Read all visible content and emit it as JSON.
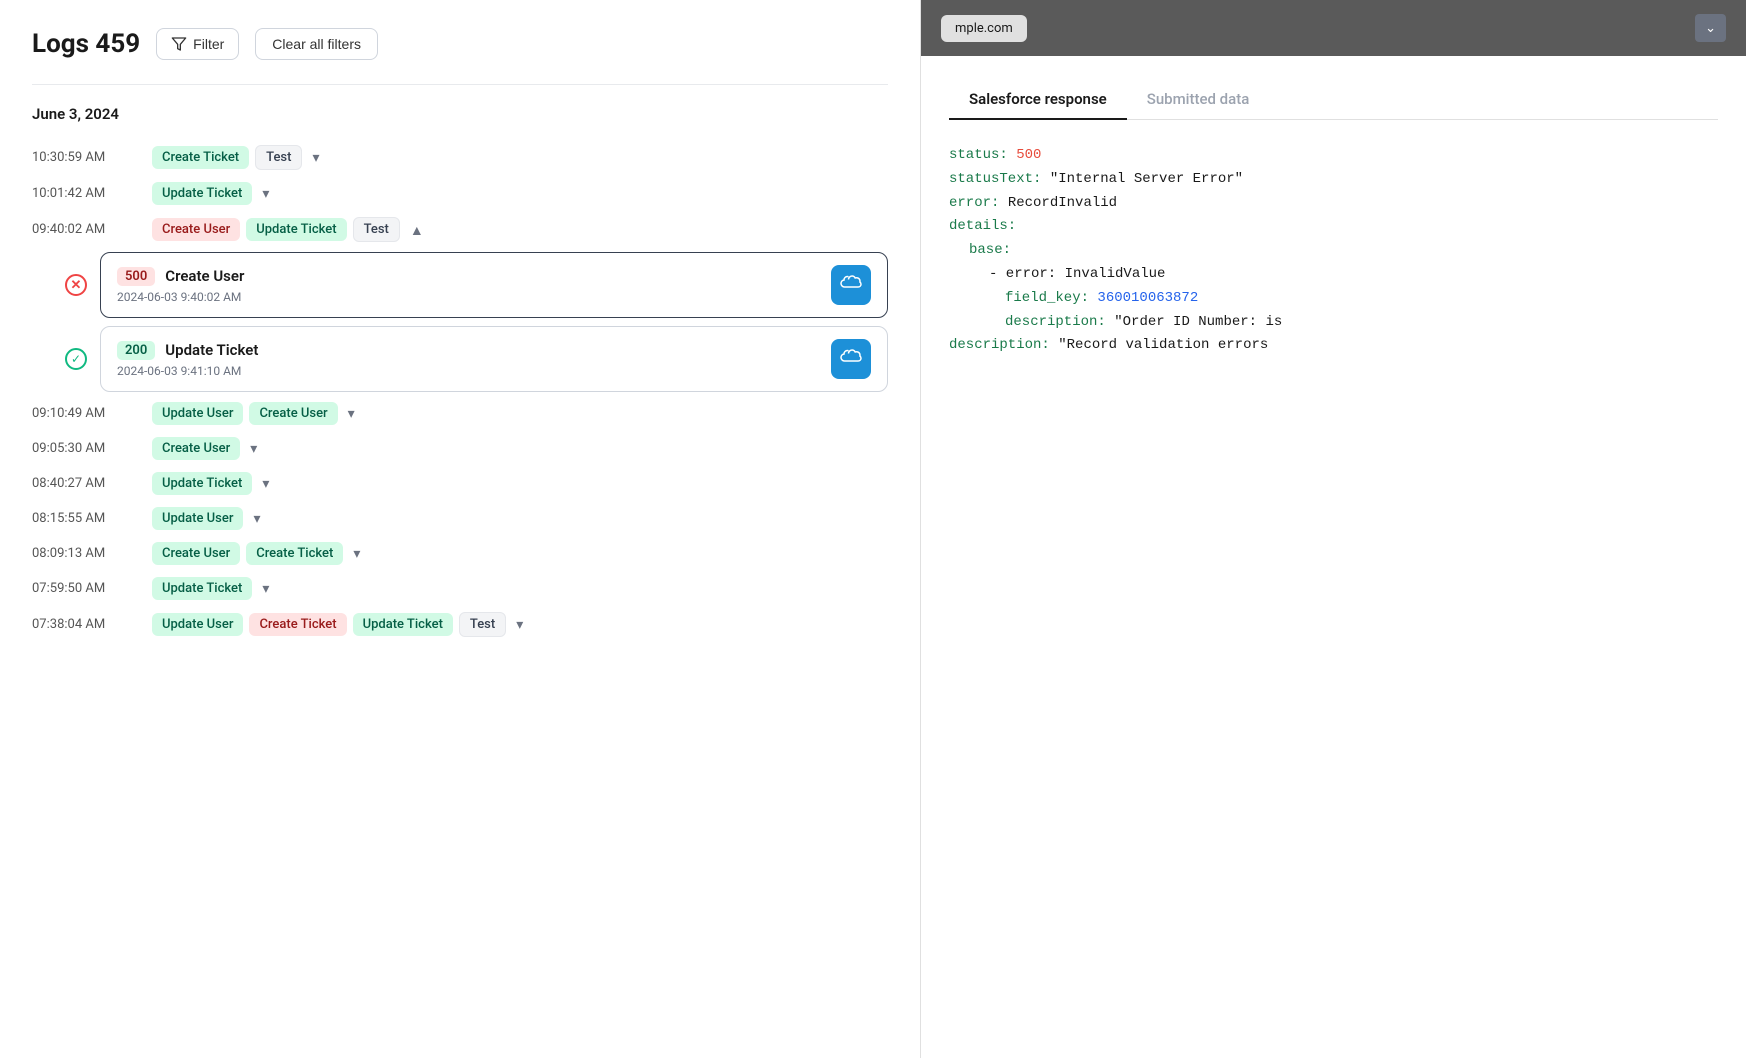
{
  "header": {
    "title": "Logs 459",
    "filter_label": "Filter",
    "clear_filters_label": "Clear all filters"
  },
  "date_section": {
    "date": "June 3, 2024"
  },
  "logs": [
    {
      "time": "10:30:59 AM",
      "tags": [
        {
          "label": "Create Ticket",
          "type": "green"
        },
        {
          "label": "Test",
          "type": "gray"
        }
      ],
      "has_chevron": true,
      "expanded": false
    },
    {
      "time": "10:01:42 AM",
      "tags": [
        {
          "label": "Update Ticket",
          "type": "green"
        }
      ],
      "has_chevron": true,
      "expanded": false
    },
    {
      "time": "09:40:02 AM",
      "tags": [
        {
          "label": "Create User",
          "type": "red"
        },
        {
          "label": "Update Ticket",
          "type": "green"
        },
        {
          "label": "Test",
          "type": "gray"
        }
      ],
      "has_chevron": true,
      "expanded": true,
      "sub_items": [
        {
          "status_code": "500",
          "status_type": "error",
          "name": "Create User",
          "datetime": "2024-06-03 9:40:02 AM",
          "selected": true
        },
        {
          "status_code": "200",
          "status_type": "success",
          "name": "Update Ticket",
          "datetime": "2024-06-03 9:41:10 AM",
          "selected": false
        }
      ]
    },
    {
      "time": "09:10:49 AM",
      "tags": [
        {
          "label": "Update User",
          "type": "green"
        },
        {
          "label": "Create User",
          "type": "green"
        }
      ],
      "has_chevron": true,
      "expanded": false
    },
    {
      "time": "09:05:30 AM",
      "tags": [
        {
          "label": "Create User",
          "type": "green"
        }
      ],
      "has_chevron": true,
      "expanded": false
    },
    {
      "time": "08:40:27 AM",
      "tags": [
        {
          "label": "Update Ticket",
          "type": "green"
        }
      ],
      "has_chevron": true,
      "expanded": false
    },
    {
      "time": "08:15:55 AM",
      "tags": [
        {
          "label": "Update User",
          "type": "green"
        }
      ],
      "has_chevron": true,
      "expanded": false
    },
    {
      "time": "08:09:13 AM",
      "tags": [
        {
          "label": "Create User",
          "type": "green"
        },
        {
          "label": "Create Ticket",
          "type": "green"
        }
      ],
      "has_chevron": true,
      "expanded": false
    },
    {
      "time": "07:59:50 AM",
      "tags": [
        {
          "label": "Update Ticket",
          "type": "green"
        }
      ],
      "has_chevron": true,
      "expanded": false
    },
    {
      "time": "07:38:04 AM",
      "tags": [
        {
          "label": "Update User",
          "type": "green"
        },
        {
          "label": "Create Ticket",
          "type": "red"
        },
        {
          "label": "Update Ticket",
          "type": "green"
        },
        {
          "label": "Test",
          "type": "gray"
        }
      ],
      "has_chevron": true,
      "expanded": false
    }
  ],
  "right_panel": {
    "domain": "mple.com",
    "tabs": [
      {
        "label": "Salesforce response",
        "active": true
      },
      {
        "label": "Submitted data",
        "active": false
      }
    ],
    "response": {
      "status_key": "status:",
      "status_value": "500",
      "statusText_key": "statusText:",
      "statusText_value": "\"Internal Server Error\"",
      "error_key": "error:",
      "error_value": "RecordInvalid",
      "details_key": "details:",
      "base_key": "base:",
      "sub_error_key": "- error:",
      "sub_error_value": "InvalidValue",
      "field_key_key": "field_key:",
      "field_key_value": "360010063872",
      "description1_key": "description:",
      "description1_value": "\"Order ID Number: is",
      "description2_key": "description:",
      "description2_value": "\"Record validation errors"
    }
  }
}
